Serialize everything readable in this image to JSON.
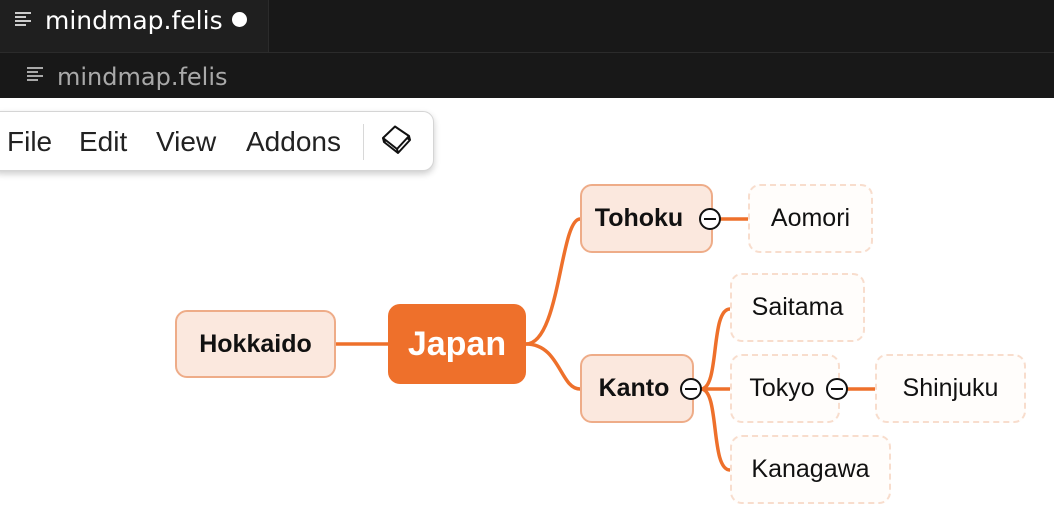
{
  "editor": {
    "tab_title": "mindmap.felis",
    "breadcrumb_title": "mindmap.felis",
    "tab_icon": "file-lines-icon",
    "breadcrumb_icon": "file-lines-icon",
    "unsaved_indicator": "dot"
  },
  "menu": {
    "items": [
      "File",
      "Edit",
      "View",
      "Addons"
    ],
    "extra_icon": "book-icon"
  },
  "mindmap": {
    "root": "Japan",
    "nodes": {
      "hokkaido": "Hokkaido",
      "tohoku": "Tohoku",
      "kanto": "Kanto",
      "aomori": "Aomori",
      "saitama": "Saitama",
      "tokyo": "Tokyo",
      "kanagawa": "Kanagawa",
      "shinjuku": "Shinjuku"
    },
    "colors": {
      "accent": "#ee702b",
      "branch_fill": "#fbe8de",
      "branch_border": "#eeac88",
      "leaf_border": "#f8ddcd"
    }
  }
}
